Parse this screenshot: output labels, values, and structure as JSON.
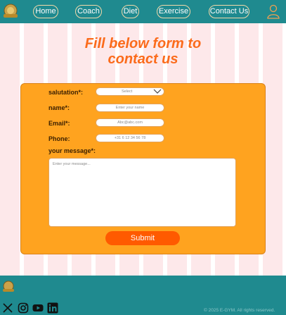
{
  "nav": {
    "items": [
      "Home",
      "Coach",
      "Diet",
      "Exercise",
      "Contact Us"
    ]
  },
  "page": {
    "title": "Fill below form to contact us"
  },
  "form": {
    "salutation_label": "salutation*:",
    "salutation_value": "Select",
    "name_label": "name*:",
    "name_placeholder": "Enter your name",
    "email_label": "Email*:",
    "email_placeholder": "Abc@abc.com",
    "phone_label": "Phone:",
    "phone_placeholder": "+31 6 12 34 56 78",
    "message_label": "your message*:",
    "message_placeholder": "Enter your message...",
    "submit_label": "Submit"
  },
  "footer": {
    "copyright": "© 2025 E-GYM. All rights reserved."
  },
  "colors": {
    "header": "#1f8a8f",
    "accent": "#fb6b1b",
    "panel": "#ffa31f",
    "button": "#ff5a00"
  }
}
